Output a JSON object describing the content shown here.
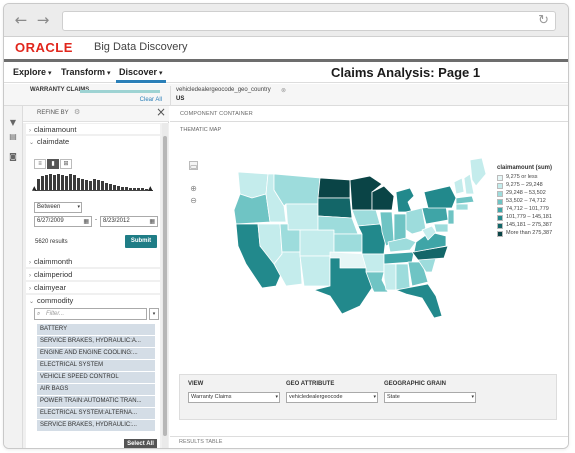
{
  "app": {
    "logo": "ORACLE",
    "product": "Big Data Discovery",
    "page_title": "Claims Analysis: Page 1"
  },
  "menu": [
    {
      "label": "Explore"
    },
    {
      "label": "Transform"
    },
    {
      "label": "Discover"
    }
  ],
  "breadcrumbs": {
    "first_label": "WARRANTY CLAIMS",
    "clear_all": "Clear All",
    "second_label": "vehicledealergeocode_geo_country",
    "second_value": "US"
  },
  "refine": {
    "title": "REFINE BY",
    "facets_top": [
      "claimamount",
      "claimdate"
    ],
    "histogram_fraction": [
      0.55,
      0.7,
      0.75,
      0.8,
      0.75,
      0.8,
      0.75,
      0.7,
      0.8,
      0.75,
      0.6,
      0.55,
      0.5,
      0.45,
      0.55,
      0.5,
      0.45,
      0.35,
      0.3,
      0.25,
      0.2,
      0.15,
      0.15,
      0.12,
      0.1,
      0.1,
      0.08,
      0.05
    ],
    "range_mode": "Between",
    "date_from": "6/27/2009",
    "date_to": "8/23/2012",
    "results": "5620 results",
    "submit": "Submit",
    "facets_mid": [
      "claimmonth",
      "claimperiod",
      "claimyear",
      "commodity"
    ],
    "filter_placeholder": "Filter...",
    "commodities": [
      "BATTERY",
      "SERVICE BRAKES, HYDRAULIC:A...",
      "ENGINE AND ENGINE COOLING:...",
      "ELECTRICAL SYSTEM",
      "VEHICLE SPEED CONTROL",
      "AIR BAGS",
      "POWER TRAIN:AUTOMATIC TRAN...",
      "ELECTRICAL SYSTEM:ALTERNA...",
      "SERVICE BRAKES, HYDRAULIC:..."
    ],
    "select_all": "Select All"
  },
  "main": {
    "component_container": "COMPONENT CONTAINER",
    "thematic_map": "THEMATIC MAP",
    "legend": {
      "title": "claimamount (sum)",
      "items": [
        {
          "label": "9,275 or less",
          "color": "#e6f6f6"
        },
        {
          "label": "9,275 – 29,248",
          "color": "#c4ecec"
        },
        {
          "label": "29,248 – 53,502",
          "color": "#9ddcdc"
        },
        {
          "label": "53,502 – 74,712",
          "color": "#6fc4c4"
        },
        {
          "label": "74,712 – 101,779",
          "color": "#3fa5a7"
        },
        {
          "label": "101,779 – 145,181",
          "color": "#22898c"
        },
        {
          "label": "145,181 – 275,387",
          "color": "#136668"
        },
        {
          "label": "More than 275,387",
          "color": "#0a4446"
        }
      ]
    },
    "controls": {
      "view_label": "VIEW",
      "view_value": "Warranty Claims",
      "geo_label": "GEO ATTRIBUTE",
      "geo_value": "vehicledealergeocode",
      "grain_label": "GEOGRAPHIC GRAIN",
      "grain_value": "State"
    },
    "results_table": "RESULTS TABLE"
  }
}
